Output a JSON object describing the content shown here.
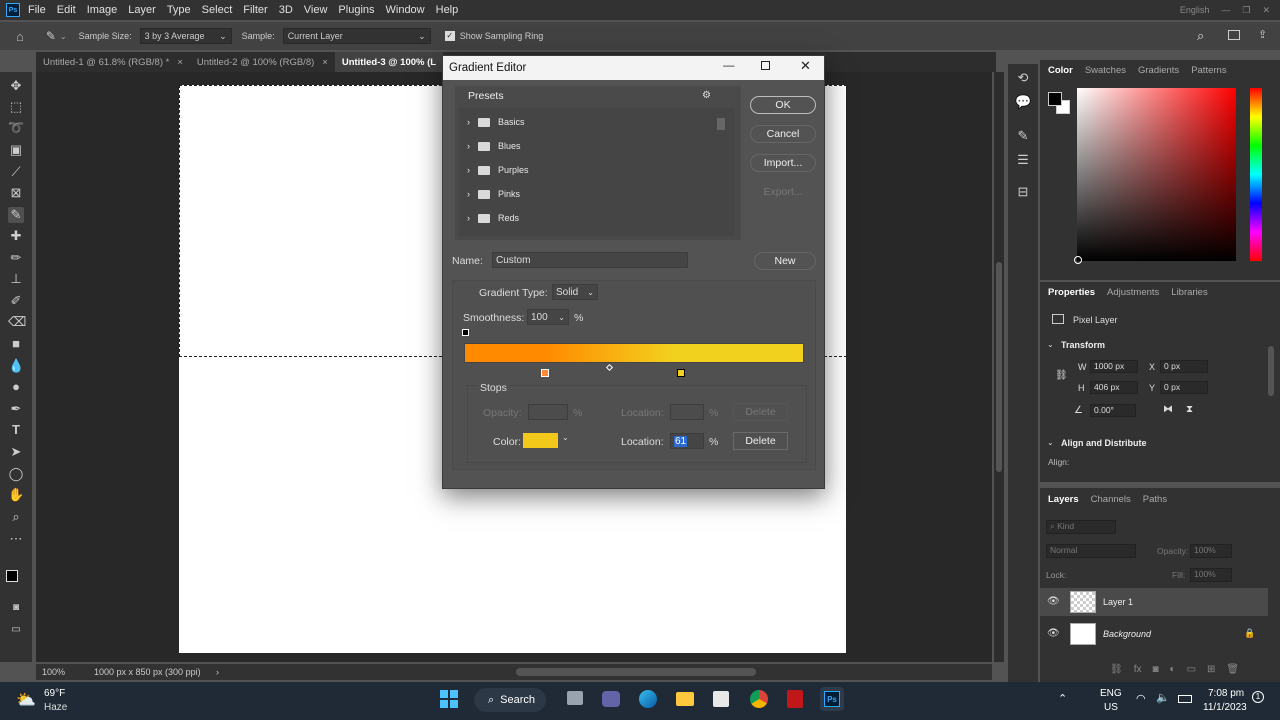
{
  "menubar": {
    "logo": "Ps",
    "items": [
      "File",
      "Edit",
      "Image",
      "Layer",
      "Type",
      "Select",
      "Filter",
      "3D",
      "View",
      "Plugins",
      "Window",
      "Help"
    ],
    "lang": "English"
  },
  "options": {
    "sample_size_label": "Sample Size:",
    "sample_size_value": "3 by 3 Average",
    "sample_label": "Sample:",
    "sample_value": "Current Layer",
    "show_ring_label": "Show Sampling Ring",
    "show_ring_checked": true
  },
  "tabs": [
    {
      "label": "Untitled-1 @ 61.8% (RGB/8) *",
      "close": "×"
    },
    {
      "label": "Untitled-2 @ 100% (RGB/8)",
      "close": "×"
    },
    {
      "label": "Untitled-3 @ 100% (L",
      "close": ""
    }
  ],
  "status": {
    "zoom": "100%",
    "doc_info": "1000 px x 850 px (300 ppi)",
    "arrow": "›"
  },
  "color_panel": {
    "tabs": [
      "Color",
      "Swatches",
      "Gradients",
      "Patterns"
    ]
  },
  "properties": {
    "tabs": [
      "Properties",
      "Adjustments",
      "Libraries"
    ],
    "kind": "Pixel Layer",
    "transform_label": "Transform",
    "w_label": "W",
    "w_value": "1000 px",
    "x_label": "X",
    "x_value": "0 px",
    "h_label": "H",
    "h_value": "406 px",
    "y_label": "Y",
    "y_value": "0 px",
    "angle_value": "0.00°",
    "align_label": "Align and Distribute",
    "align_sub": "Align:"
  },
  "layers_panel": {
    "tabs": [
      "Layers",
      "Channels",
      "Paths"
    ],
    "kind_placeholder": "Kind",
    "blend": "Normal",
    "opacity_label": "Opacity:",
    "opacity_value": "100%",
    "lock_label": "Lock:",
    "fill_label": "Fill:",
    "fill_value": "100%",
    "layers": [
      {
        "name": "Layer 1",
        "selected": true
      },
      {
        "name": "Background",
        "selected": false
      }
    ]
  },
  "dialog": {
    "title": "Gradient Editor",
    "presets_label": "Presets",
    "presets": [
      "Basics",
      "Blues",
      "Purples",
      "Pinks",
      "Reds"
    ],
    "ok": "OK",
    "cancel": "Cancel",
    "import": "Import...",
    "export": "Export...",
    "name_label": "Name:",
    "name_value": "Custom",
    "new": "New",
    "gradient_type_label": "Gradient Type:",
    "gradient_type_value": "Solid",
    "smoothness_label": "Smoothness:",
    "smoothness_value": "100",
    "percent": "%",
    "stops_label": "Stops",
    "opacity_label": "Opacity:",
    "location_label": "Location:",
    "delete": "Delete",
    "color_label": "Color:",
    "location_value": "61",
    "gradient_start_color": "#ff8a00",
    "gradient_end_color": "#f2d01e",
    "selected_color": "#f2c81a"
  },
  "taskbar": {
    "temp": "69°F",
    "weather": "Haze",
    "search": "Search",
    "lang": "ENG",
    "region": "US",
    "time": "7:08 pm",
    "date": "11/1/2023"
  }
}
